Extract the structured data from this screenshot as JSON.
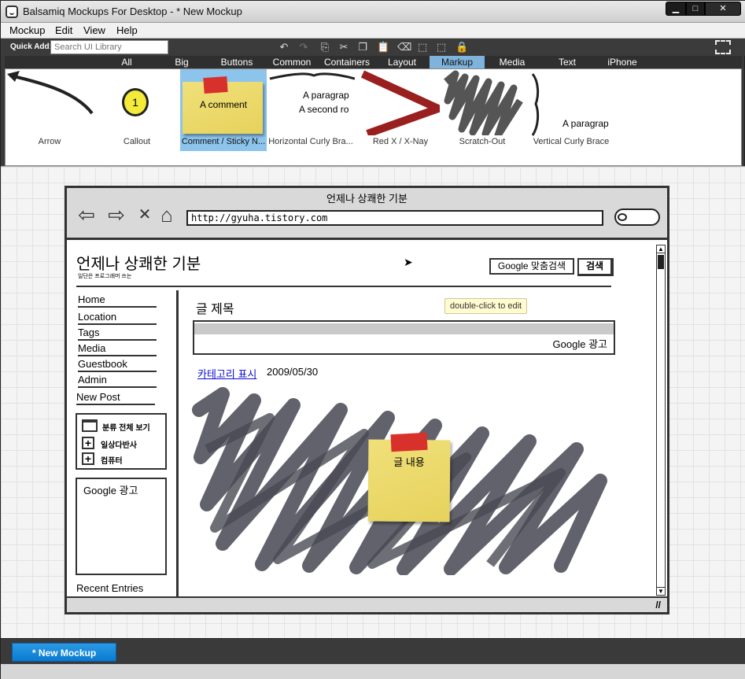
{
  "window": {
    "title": "Balsamiq Mockups For Desktop - * New Mockup"
  },
  "menu": [
    "Mockup",
    "Edit",
    "View",
    "Help"
  ],
  "quick_add": {
    "label": "Quick Add:",
    "placeholder": "Search UI Library"
  },
  "toolbar_icons": [
    "undo-icon",
    "redo-icon",
    "copy-icon",
    "cut-icon",
    "duplicate-icon",
    "paste-icon",
    "eraser-icon",
    "group-icon",
    "ungroup-icon",
    "lock-icon"
  ],
  "tabs": [
    {
      "label": "All",
      "selected": false
    },
    {
      "label": "Big",
      "selected": false
    },
    {
      "label": "Buttons",
      "selected": false
    },
    {
      "label": "Common",
      "selected": false
    },
    {
      "label": "Containers",
      "selected": false
    },
    {
      "label": "Layout",
      "selected": false
    },
    {
      "label": "Markup",
      "selected": true
    },
    {
      "label": "Media",
      "selected": false
    },
    {
      "label": "Text",
      "selected": false
    },
    {
      "label": "iPhone",
      "selected": false
    }
  ],
  "library": {
    "items": [
      "Arrow",
      "Callout",
      "Comment / Sticky N...",
      "Horizontal Curly Bra...",
      "Red X / X-Nay",
      "Scratch-Out",
      "Vertical Curly Brace"
    ],
    "selected_index": 2,
    "callout_number": "1",
    "comment_text": "A comment",
    "paragraph_line1": "A paragrap",
    "paragraph_line2": "A second ro",
    "vbrace_text": "A paragrap"
  },
  "mockup": {
    "browser_title": "언제나 상쾌한 기분",
    "url": "http://gyuha.tistory.com",
    "site_title": "언제나 상쾌한 기분",
    "site_subtitle": "일단은 프로그래머 쓰는",
    "google_search_label": "Google 맞춤검색",
    "search_button": "검색",
    "nav": [
      "Home",
      "Location",
      "Tags",
      "Media",
      "Guestbook",
      "Admin",
      "New Post"
    ],
    "tree": {
      "root": "분류 전체 보기",
      "children": [
        "일상다반사",
        "컴퓨터"
      ]
    },
    "google_ad_side": "Google 광고",
    "recent_entries": "Recent Entries",
    "post_title": "글 제목",
    "google_ad_top": "Google 광고",
    "category_link": "카테고리 표시",
    "post_date": "2009/05/30",
    "sticky_text": "글 내용",
    "tooltip": "double-click to edit"
  },
  "taskbar": {
    "new_mockup": "* New Mockup"
  },
  "colors": {
    "selected_tab": "#7fb3dc",
    "sticky": "#ebd964",
    "tape": "#d8312b",
    "red_x": "#9a1f1f",
    "task_button": "#1a8be0"
  }
}
